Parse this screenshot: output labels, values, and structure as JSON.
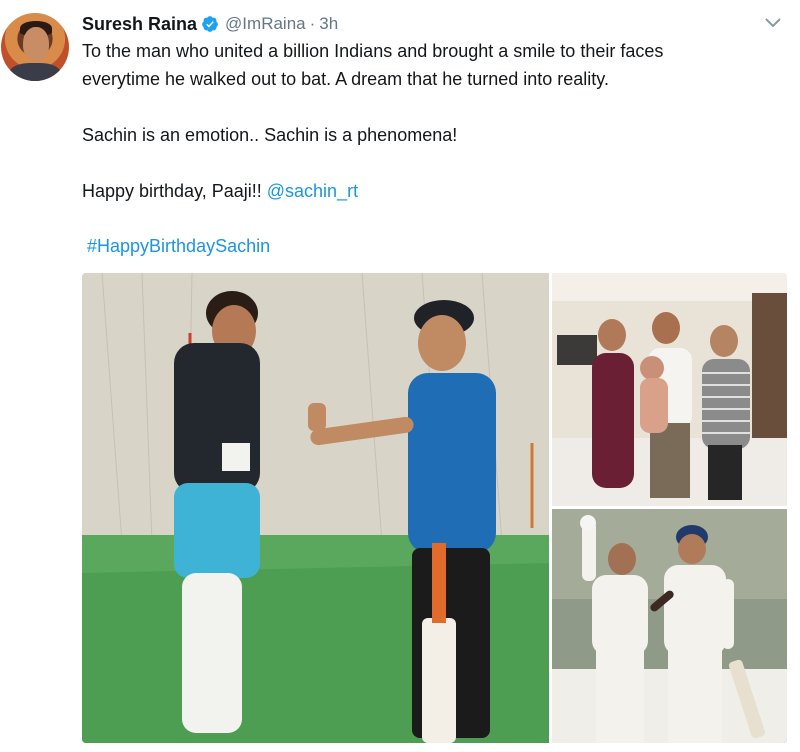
{
  "tweet": {
    "author_name": "Suresh Raina",
    "handle": "@ImRaina",
    "separator": "·",
    "time": "3h",
    "lines": [
      "To the man who united a billion Indians and brought a smile to their faces",
      "everytime he walked out to bat. A dream that he turned into reality.",
      "Sachin is an emotion.. Sachin is a phenomena!",
      "Happy birthday, Paaji!! "
    ],
    "mention": "@sachin_rt",
    "hashtag": "#HappyBirthdaySachin"
  },
  "icons": {
    "verified": "verified-badge-icon",
    "menu": "chevron-down-icon"
  },
  "colors": {
    "link": "#1b95e0",
    "verified": "#1da1f2",
    "muted": "#657786",
    "text": "#14171a"
  }
}
